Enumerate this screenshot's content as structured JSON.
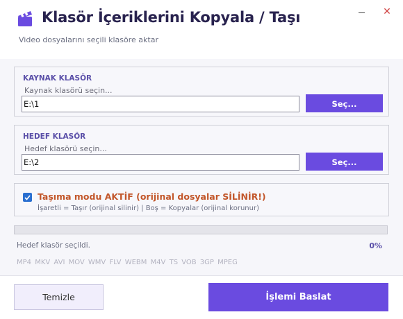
{
  "window": {
    "title": "Klasör İçeriklerini Kopyala / Taşı",
    "subtitle": "Video dosyalarını seçili klasöre aktar",
    "minimize_icon": "minimize-icon",
    "close_glyph": "✕",
    "accent_color": "#6a4be0"
  },
  "source": {
    "label": "KAYNAK KLASÖR",
    "placeholder": "Kaynak klasörü seçin...",
    "value": "E:\\1",
    "button_label": "Seç..."
  },
  "target": {
    "label": "HEDEF KLASÖR",
    "placeholder": "Hedef klasörü seçin...",
    "value": "E:\\2",
    "button_label": "Seç..."
  },
  "mode": {
    "checked": true,
    "title": "Taşıma modu AKTİF  (orijinal dosyalar SİLİNİR!)",
    "hint": "İşaretli = Taşır (orijinal silinir)   |   Boş = Kopyalar (orijinal korunur)"
  },
  "progress": {
    "fraction": 0,
    "status": "Hedef klasör seçildi.",
    "percent": "0%"
  },
  "formats": "MP4 MKV AVI MOV WMV FLV WEBM M4V TS VOB 3GP MPEG",
  "footer": {
    "clear_label": "Temizle",
    "start_label": "İşlemi Baslat"
  }
}
